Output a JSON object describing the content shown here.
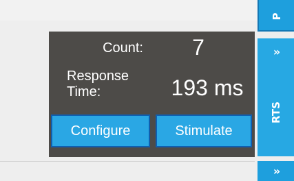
{
  "panel": {
    "count_label": "Count:",
    "count_value": "7",
    "response_label": "Response\nTime:",
    "response_value": "193 ms",
    "configure_label": "Configure",
    "stimulate_label": "Stimulate"
  },
  "side_tabs": {
    "top_label": "P",
    "mid_expand": "»",
    "mid_label": "RTS",
    "bottom_expand": "»"
  },
  "colors": {
    "panel_bg": "#4d4b48",
    "button_bg": "#2aa7e4",
    "button_border": "#0f5fb0",
    "tab_bg": "#1e9fdd",
    "page_bg": "#eeeeee"
  }
}
